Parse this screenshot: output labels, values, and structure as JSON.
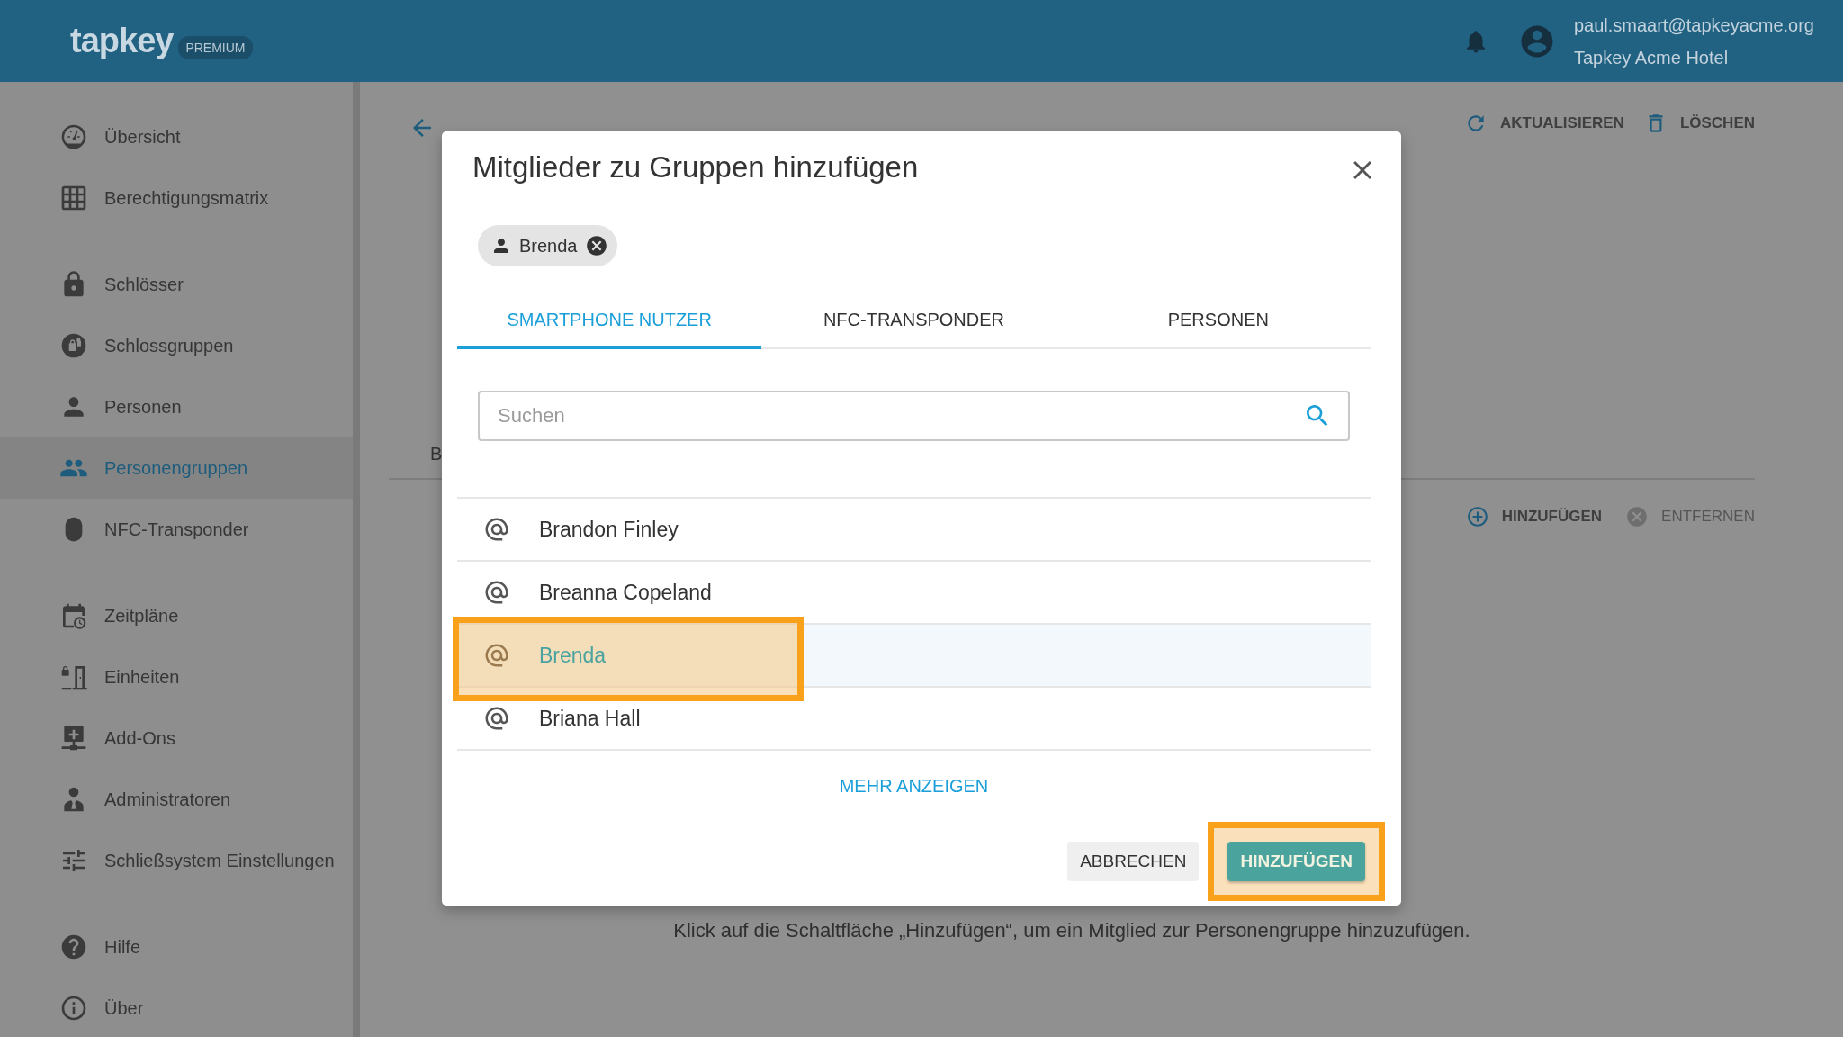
{
  "header": {
    "logo": "tapkey",
    "badge": "PREMIUM",
    "user_email": "paul.smaart@tapkeyacme.org",
    "user_org": "Tapkey Acme Hotel"
  },
  "sidebar": {
    "groups": [
      [
        {
          "label": "Übersicht",
          "selected": false
        },
        {
          "label": "Berechtigungsmatrix",
          "selected": false
        }
      ],
      [
        {
          "label": "Schlösser",
          "selected": false
        },
        {
          "label": "Schlossgruppen",
          "selected": false
        },
        {
          "label": "Personen",
          "selected": false
        },
        {
          "label": "Personengruppen",
          "selected": true
        },
        {
          "label": "NFC-Transponder",
          "selected": false
        }
      ],
      [
        {
          "label": "Zeitpläne",
          "selected": false
        },
        {
          "label": "Einheiten",
          "selected": false
        },
        {
          "label": "Add-Ons",
          "selected": false
        },
        {
          "label": "Administratoren",
          "selected": false
        },
        {
          "label": "Schließsystem Einstellungen",
          "selected": false
        }
      ],
      [
        {
          "label": "Hilfe",
          "selected": false
        },
        {
          "label": "Über",
          "selected": false
        }
      ]
    ]
  },
  "page": {
    "actions": [
      "AKTUALISIEREN",
      "LÖSCHEN"
    ],
    "tab_fragment": "B",
    "member_actions": [
      {
        "label": "HINZUFÜGEN",
        "disabled": false
      },
      {
        "label": "ENTFERNEN",
        "disabled": true
      }
    ],
    "hint": "Klick auf die Schaltfläche „Hinzufügen“, um ein Mitglied zur Personengruppe hinzuzufügen."
  },
  "dialog": {
    "title": "Mitglieder zu Gruppen hinzufügen",
    "chips": [
      {
        "label": "Brenda"
      }
    ],
    "tabs": [
      {
        "label": "SMARTPHONE NUTZER",
        "selected": true
      },
      {
        "label": "NFC-TRANSPONDER",
        "selected": false
      },
      {
        "label": "PERSONEN",
        "selected": false
      }
    ],
    "search": {
      "placeholder": "Suchen"
    },
    "results": [
      {
        "name": "Brandon Finley",
        "selected": false,
        "highlighted": false
      },
      {
        "name": "Breanna Copeland",
        "selected": false,
        "highlighted": false
      },
      {
        "name": "Brenda",
        "selected": true,
        "highlighted": true
      },
      {
        "name": "Briana Hall",
        "selected": false,
        "highlighted": false
      }
    ],
    "more_link": "MEHR ANZEIGEN",
    "buttons": [
      {
        "label": "ABBRECHEN",
        "kind": "secondary",
        "highlighted": false
      },
      {
        "label": "HINZUFÜGEN",
        "kind": "primary",
        "highlighted": true
      }
    ]
  }
}
